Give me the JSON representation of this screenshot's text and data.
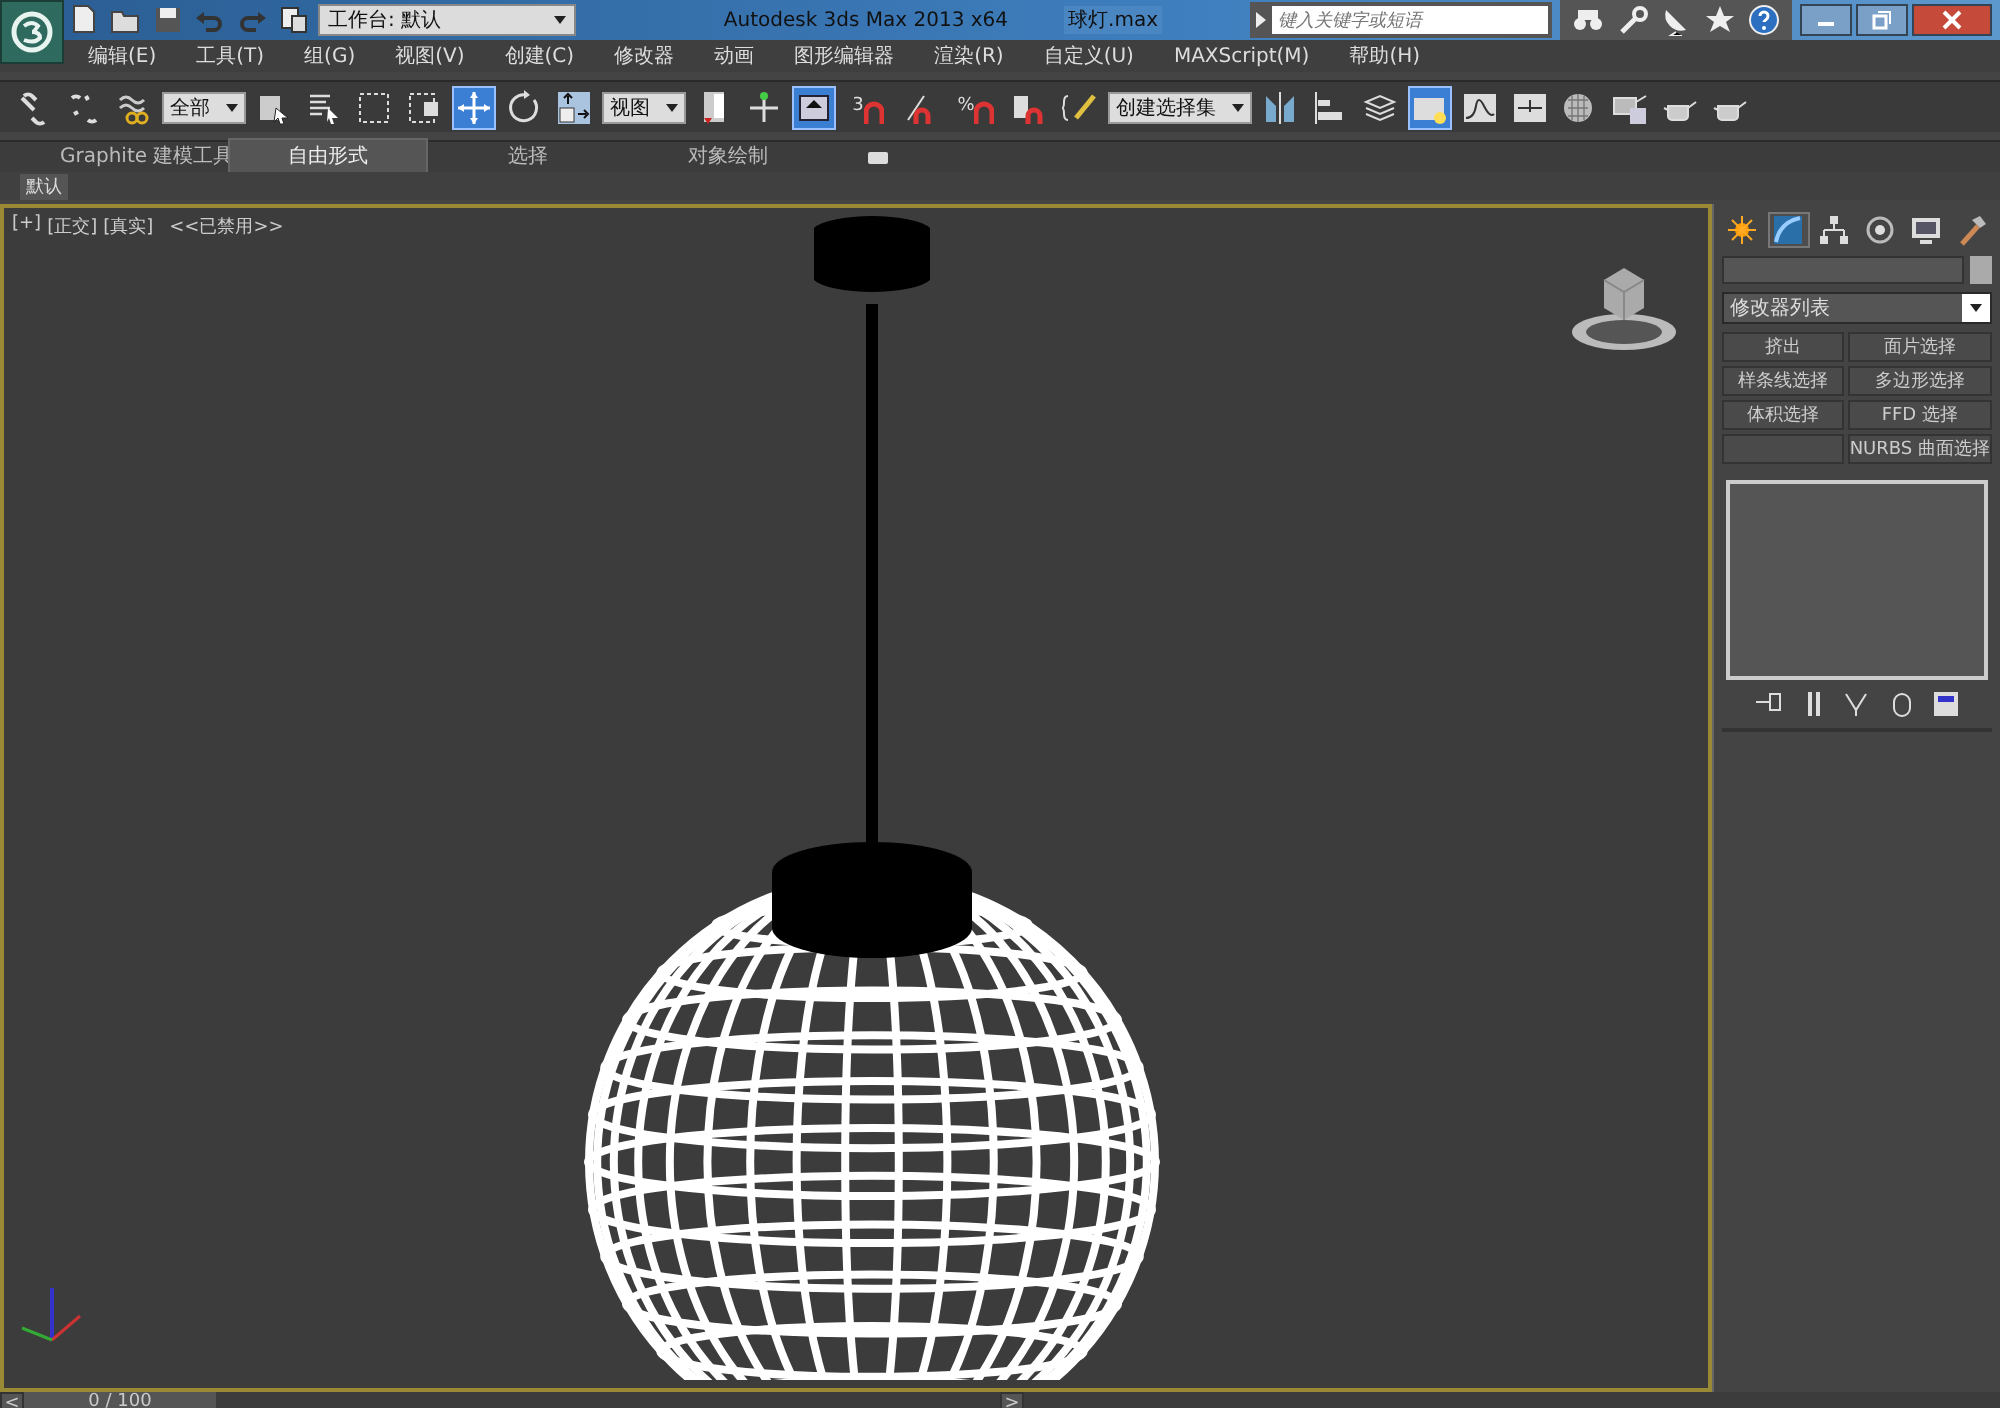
{
  "title_bar": {
    "workspace": "工作台: 默认",
    "app_title": "Autodesk 3ds Max  2013 x64",
    "file_name": "球灯.max",
    "search": {
      "placeholder": "键入关键字或短语"
    }
  },
  "menu": [
    "编辑(E)",
    "工具(T)",
    "组(G)",
    "视图(V)",
    "创建(C)",
    "修改器",
    "动画",
    "图形编辑器",
    "渲染(R)",
    "自定义(U)",
    "MAXScript(M)",
    "帮助(H)"
  ],
  "toolbar": [
    {
      "kind": "link",
      "selected": false
    },
    {
      "kind": "unlink",
      "selected": false
    },
    {
      "kind": "bind",
      "selected": false
    },
    {
      "kind": "dropdown",
      "value": "全部"
    },
    {
      "kind": "select",
      "selected": false
    },
    {
      "kind": "list",
      "selected": false
    },
    {
      "kind": "region",
      "selected": false
    },
    {
      "kind": "crossing",
      "selected": false
    },
    {
      "kind": "move",
      "selected": true
    },
    {
      "kind": "rotate",
      "selected": false
    },
    {
      "kind": "scale",
      "selected": false
    },
    {
      "kind": "dropdown",
      "value": "视图"
    },
    {
      "kind": "pivot",
      "selected": false
    },
    {
      "kind": "manip",
      "selected": false
    },
    {
      "kind": "keyboard",
      "selected": true
    },
    {
      "kind": "snap",
      "selected": false,
      "glyph": "3"
    },
    {
      "kind": "angle",
      "selected": false
    },
    {
      "kind": "percent",
      "selected": false,
      "glyph": "%"
    },
    {
      "kind": "spinner",
      "selected": false
    },
    {
      "kind": "edit",
      "selected": false
    },
    {
      "kind": "dropdown",
      "value": "创建选择集"
    },
    {
      "kind": "mirror",
      "selected": false
    },
    {
      "kind": "align",
      "selected": false
    },
    {
      "kind": "layers",
      "selected": false
    },
    {
      "kind": "explorer",
      "selected": true
    },
    {
      "kind": "curve",
      "selected": false
    },
    {
      "kind": "schematic",
      "selected": false
    },
    {
      "kind": "material",
      "selected": false
    },
    {
      "kind": "render",
      "selected": false
    },
    {
      "kind": "teapot",
      "selected": false
    },
    {
      "kind": "teapot",
      "selected": false
    }
  ],
  "ribbon_tabs": [
    {
      "label": "Graphite 建模工具",
      "selected": false
    },
    {
      "label": "自由形式",
      "selected": true
    },
    {
      "label": "选择",
      "selected": false
    },
    {
      "label": "对象绘制",
      "selected": false
    }
  ],
  "ribbon_sub": "默认",
  "viewport": {
    "labels": [
      "[+]",
      "[正交]",
      "[真实]",
      "<<已禁用>>"
    ]
  },
  "command_panel": {
    "tabs": [
      {
        "kind": "create",
        "selected": false
      },
      {
        "kind": "modify",
        "selected": true
      },
      {
        "kind": "hierarchy",
        "selected": false
      },
      {
        "kind": "motion",
        "selected": false
      },
      {
        "kind": "display",
        "selected": false
      },
      {
        "kind": "utilities",
        "selected": false
      }
    ],
    "modifier_list": "修改器列表",
    "buttons": [
      {
        "kind": "button",
        "label": "挤出"
      },
      {
        "kind": "button",
        "label": "面片选择"
      },
      {
        "kind": "button",
        "label": "样条线选择"
      },
      {
        "kind": "button",
        "label": "多边形选择"
      },
      {
        "kind": "button",
        "label": "体积选择"
      },
      {
        "kind": "button",
        "label": "FFD 选择"
      },
      {
        "kind": "blank"
      },
      {
        "kind": "button",
        "label": "NURBS 曲面选择"
      }
    ]
  },
  "timeline": {
    "prev": "<",
    "frame": "0 / 100",
    "level": 0,
    "next": ">"
  }
}
